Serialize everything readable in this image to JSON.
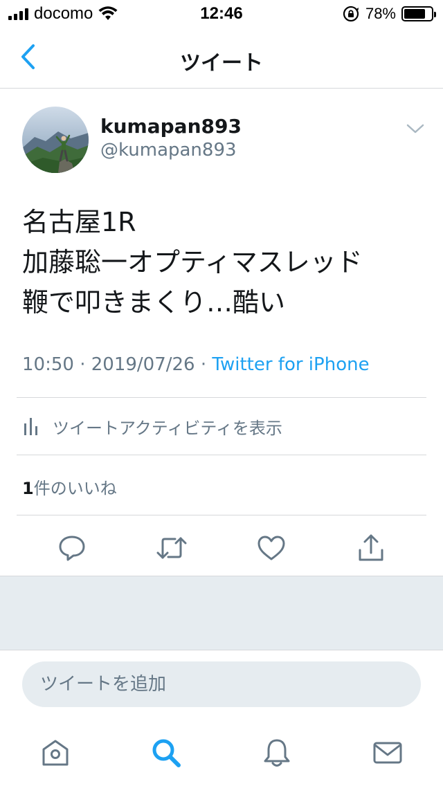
{
  "status_bar": {
    "carrier": "docomo",
    "time": "12:46",
    "battery_percent_label": "78%",
    "battery_level": 0.78
  },
  "nav": {
    "title": "ツイート",
    "back_icon": "chevron-left-icon"
  },
  "tweet": {
    "user_name": "kumapan893",
    "user_handle": "@kumapan893",
    "text_lines": [
      "名古屋1R",
      "加藤聡一オプティマスレッド",
      "鞭で叩きまくり…酷い"
    ],
    "time": "10:50",
    "date": "2019/07/26",
    "separator": " · ",
    "source": "Twitter for iPhone",
    "activity_label": "ツイートアクティビティを表示",
    "like_count": "1",
    "like_label": "件のいいね"
  },
  "actions": {
    "reply_icon": "reply-icon",
    "retweet_icon": "retweet-icon",
    "like_icon": "heart-icon",
    "share_icon": "share-icon"
  },
  "compose": {
    "placeholder": "ツイートを追加"
  },
  "tab_bar": {
    "items": [
      "home-icon",
      "search-icon",
      "notifications-icon",
      "messages-icon"
    ]
  },
  "colors": {
    "accent": "#1da1f2",
    "secondary_text": "#657786",
    "primary_text": "#14171a",
    "divider": "#d6d8da",
    "panel_background": "#e6ecf0"
  }
}
